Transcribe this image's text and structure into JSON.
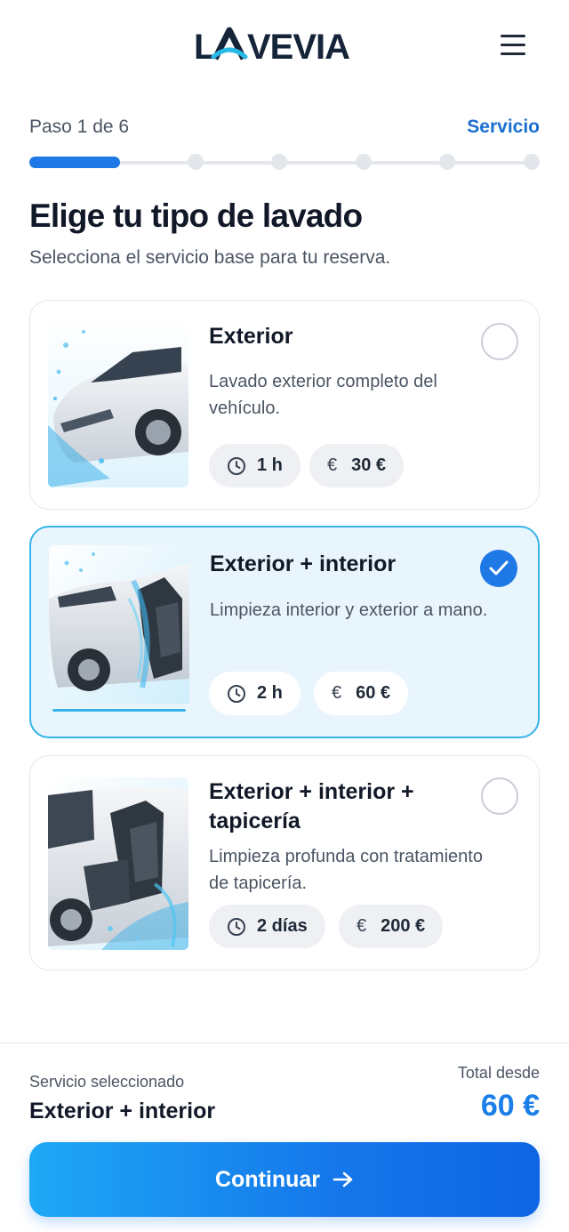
{
  "brand": {
    "name": "LAVEVIA"
  },
  "header": {
    "menu_icon": "hamburger-menu-icon"
  },
  "progress": {
    "step_text": "Paso 1 de 6",
    "step_name": "Servicio",
    "current_step": 1,
    "total_steps": 6
  },
  "page": {
    "title": "Elige tu tipo de lavado",
    "subtitle": "Selecciona el servicio base para tu reserva."
  },
  "services": [
    {
      "title": "Exterior",
      "description": "Lavado exterior completo del vehículo.",
      "duration": "1 h",
      "price": "30 €",
      "currency_symbol": "€",
      "selected": false
    },
    {
      "title": "Exterior + interior",
      "description": "Limpieza interior y exterior a mano.",
      "duration": "2 h",
      "price": "60 €",
      "currency_symbol": "€",
      "selected": true
    },
    {
      "title": "Exterior + interior + tapicería",
      "description": "Limpieza profunda con tratamiento de tapicería.",
      "duration": "2 días",
      "price": "200 €",
      "currency_symbol": "€",
      "selected": false
    }
  ],
  "summary": {
    "selected_label": "Servicio seleccionado",
    "selected_value": "Exterior + interior",
    "total_label": "Total desde",
    "total_value": "60 €"
  },
  "cta": {
    "label": "Continuar"
  },
  "colors": {
    "accent": "#1e78e6",
    "selected_border": "#36b4ea",
    "selected_bg": "#e9f5fd",
    "logo_teal": "#28b9e6"
  }
}
